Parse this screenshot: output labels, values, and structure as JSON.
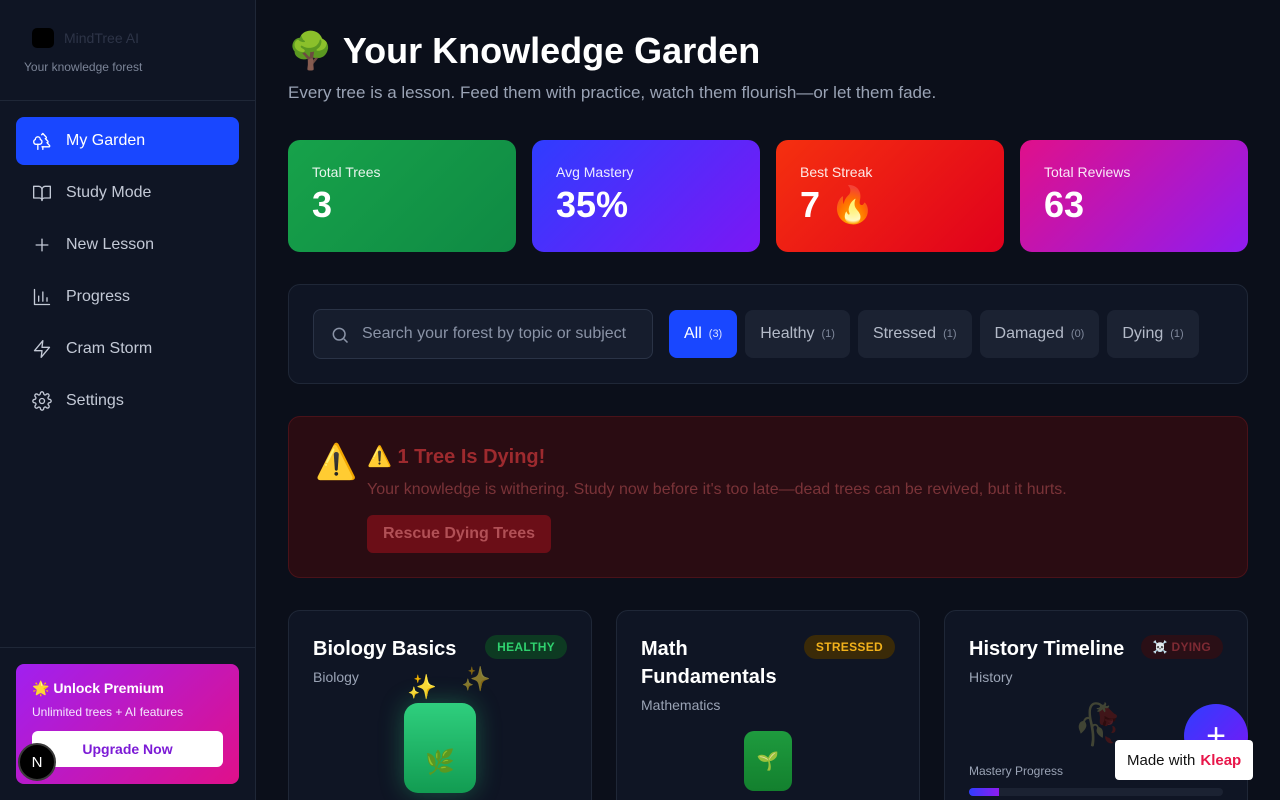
{
  "brand": {
    "name": "MindTree AI",
    "tagline": "Your knowledge forest"
  },
  "nav": [
    {
      "label": "My Garden",
      "icon": "tree-icon",
      "active": true
    },
    {
      "label": "Study Mode",
      "icon": "book-icon"
    },
    {
      "label": "New Lesson",
      "icon": "plus-icon"
    },
    {
      "label": "Progress",
      "icon": "bar-chart-icon"
    },
    {
      "label": "Cram Storm",
      "icon": "lightning-icon"
    },
    {
      "label": "Settings",
      "icon": "gear-icon"
    }
  ],
  "premium": {
    "title": "🌟 Unlock Premium",
    "subtitle": "Unlimited trees + AI features",
    "button": "Upgrade Now"
  },
  "n_badge": "N",
  "header": {
    "emoji": "🌳",
    "title": "Your Knowledge Garden",
    "subtitle": "Every tree is a lesson. Feed them with practice, watch them flourish—or let them fade."
  },
  "stats": [
    {
      "label": "Total Trees",
      "value": "3"
    },
    {
      "label": "Avg Mastery",
      "value": "35%"
    },
    {
      "label": "Best Streak",
      "value": "7 🔥"
    },
    {
      "label": "Total Reviews",
      "value": "63"
    }
  ],
  "search": {
    "placeholder": "Search your forest by topic or subject",
    "value": ""
  },
  "filters": [
    {
      "label": "All",
      "count": "(3)",
      "active": true
    },
    {
      "label": "Healthy",
      "count": "(1)"
    },
    {
      "label": "Stressed",
      "count": "(1)"
    },
    {
      "label": "Damaged",
      "count": "(0)"
    },
    {
      "label": "Dying",
      "count": "(1)"
    }
  ],
  "alert": {
    "icon": "⚠️",
    "title": "⚠️ 1 Tree Is Dying!",
    "text": "Your knowledge is withering. Study now before it's too late—dead trees can be revived, but it hurts.",
    "button": "Rescue Dying Trees"
  },
  "cards": [
    {
      "title": "Biology Basics",
      "subject": "Biology",
      "status": "HEALTHY"
    },
    {
      "title": "Math Fundamentals",
      "subject": "Mathematics",
      "status": "STRESSED"
    },
    {
      "title": "History Timeline",
      "subject": "History",
      "status": "☠️ DYING",
      "mastery_label": "Mastery Progress",
      "mastery_fraction": 0.12
    }
  ],
  "fab": "+",
  "made_with": {
    "prefix": "Made with",
    "brand": "Kleap"
  },
  "colors": {
    "accent": "#1947ff",
    "healthy": "#2fd16e",
    "stressed": "#f2b21b",
    "danger": "#e0001c"
  }
}
